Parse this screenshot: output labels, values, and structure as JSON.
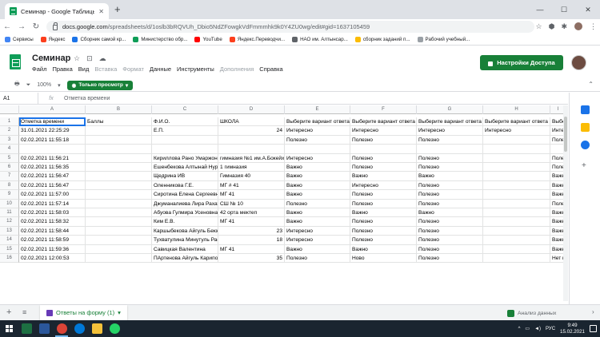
{
  "browser": {
    "tab_title": "Семинар - Google Таблицы",
    "url_host": "docs.google.com",
    "url_path": "/spreadsheets/d/1oslb3bRQVUh_Dbio5NdZFowgkVdFmmmhk9k0Y4ZU0wg/edit#gid=1637105459",
    "bookmarks": [
      {
        "label": "Сервисы",
        "color": "#4285f4"
      },
      {
        "label": "Яндекс",
        "color": "#fc3f1d"
      },
      {
        "label": "Сборник самой кр...",
        "color": "#1a73e8"
      },
      {
        "label": "Министерство обр...",
        "color": "#0f9d58"
      },
      {
        "label": "YouTube",
        "color": "#ff0000"
      },
      {
        "label": "Яндекс.Переводчи...",
        "color": "#fc3f1d"
      },
      {
        "label": "НАО им. Алтынсар...",
        "color": "#5f6368"
      },
      {
        "label": "сборник заданий п...",
        "color": "#fbbc04"
      },
      {
        "label": "Рабочий учебный...",
        "color": "#9aa0a6"
      }
    ]
  },
  "doc": {
    "title": "Семинар",
    "menu": [
      "Файл",
      "Правка",
      "Вид",
      "Вставка",
      "Формат",
      "Данные",
      "Инструменты",
      "Дополнения",
      "Справка"
    ],
    "disabled_menu": [
      "Вставка",
      "Формат",
      "Дополнения"
    ],
    "share_label": "Настройки Доступа",
    "zoom": "100%",
    "view_only_label": "Только просмотр",
    "cell_ref": "A1",
    "formula_text": "Отметка времени"
  },
  "grid": {
    "columns": [
      "A",
      "B",
      "C",
      "D",
      "E",
      "F",
      "G",
      "H",
      "I"
    ],
    "row_numbers": [
      "1",
      "2",
      "3",
      "4",
      "5",
      "6",
      "7",
      "8",
      "9",
      "10",
      "11",
      "12",
      "13",
      "14",
      "15",
      "16"
    ],
    "rows": [
      [
        "Отметка времени",
        "Баллы",
        "Ф.И.О.",
        "ШКОЛА",
        "Выберите вариант ответа",
        "Выберите вариант ответа",
        "Выберите вариант ответа",
        "Выберите вариант ответа",
        "Выбе"
      ],
      [
        "31.01.2021 22:25:29",
        "",
        "Е.П.",
        "24",
        "Интересно",
        "Интересно",
        "Интересно",
        "Интересно",
        "Инте"
      ],
      [
        "02.02.2021 11:55:18",
        "",
        "",
        "",
        "Полезно",
        "Полезно",
        "Полезно",
        "",
        "Поле"
      ],
      [
        "",
        "",
        "",
        "",
        "",
        "",
        "",
        "",
        ""
      ],
      [
        "02.02.2021 11:56:21",
        "",
        "Кириллова Рано Умаржоновна",
        "гимназия №1 им.А.Бокейханова",
        "Интересно",
        "Полезно",
        "Полезно",
        "",
        "Поле"
      ],
      [
        "02.02.2021 11:56:35",
        "",
        "Ешенбекова Алтынай Нурлановна",
        "1 гимназия",
        "Важно",
        "Полезно",
        "Полезно",
        "",
        "Поле"
      ],
      [
        "02.02.2021 11:56:47",
        "",
        "Щедрина ИВ",
        "Гимназия 40",
        "Важно",
        "Важно",
        "Важно",
        "",
        "Важн"
      ],
      [
        "02.02.2021 11:56:47",
        "",
        "Оленникова Г.Е.",
        "МГ # 41",
        "Важно",
        "Интересно",
        "Полезно",
        "",
        "Важн"
      ],
      [
        "02.02.2021 11:57:00",
        "",
        "Сиротина Елена Сергеевна",
        "МГ 41",
        "Важно",
        "Полезно",
        "Полезно",
        "",
        "Важн"
      ],
      [
        "02.02.2021 11:57:14",
        "",
        "Джуманалиева Лира Рахатовна",
        "СШ № 10",
        "Полезно",
        "Полезно",
        "Полезно",
        "",
        "Поле"
      ],
      [
        "02.02.2021 11:58:03",
        "",
        "Абуова Гулмира Усеновна",
        "42 орта мектеп",
        "Важно",
        "Важно",
        "Важно",
        "",
        "Важн"
      ],
      [
        "02.02.2021 11:58:32",
        "",
        "Ким Е.В.",
        "МГ 41",
        "Важно",
        "Полезно",
        "Полезно",
        "",
        "Важн"
      ],
      [
        "02.02.2021 11:58:44",
        "",
        "Каршыбекова Айгуль Бекжановна",
        "23",
        "Интересно",
        "Полезно",
        "Полезно",
        "",
        "Важн"
      ],
      [
        "02.02.2021 11:58:59",
        "",
        "Тухватулина Минутуль Рафаиловна",
        "18",
        "Интересно",
        "Полезно",
        "Полезно",
        "",
        "Важн"
      ],
      [
        "02.02.2021 11:59:36",
        "",
        "Савицкая Валентина",
        "МГ 41",
        "Важно",
        "Важно",
        "Полезно",
        "",
        "Важн"
      ],
      [
        "02.02.2021 12:00:53",
        "",
        "ПАртенова Айгуль Кариповна",
        "35",
        "Полезно",
        "Ново",
        "Полезно",
        "",
        "Нет н"
      ]
    ],
    "numeric_cols_d": [
      "24",
      "23",
      "18",
      "35"
    ],
    "empty_row": "16"
  },
  "sheet_tabs": {
    "active_tab": "Ответы на форму (1)",
    "explore_label": "Анализ данных"
  },
  "taskbar": {
    "lang": "РУС",
    "time": "9:49",
    "date": "15.02.2021"
  }
}
